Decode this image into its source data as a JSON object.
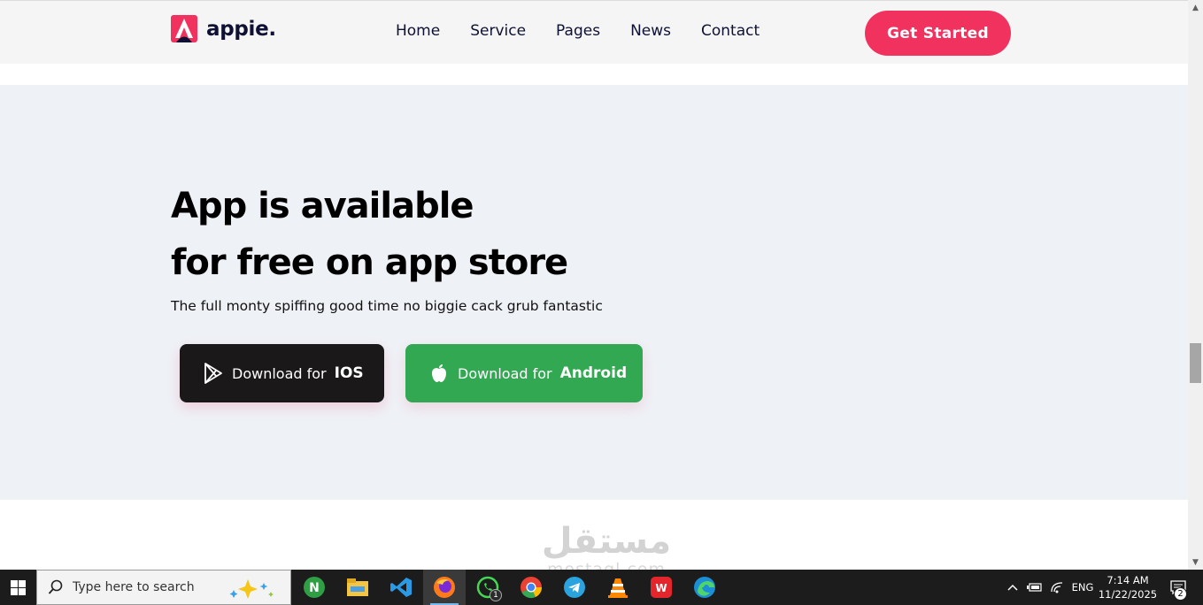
{
  "header": {
    "brand": "appie.",
    "nav": [
      "Home",
      "Service",
      "Pages",
      "News",
      "Contact"
    ],
    "cta_label": "Get Started"
  },
  "hero": {
    "title_line1": "App is available",
    "title_line2": "for free on app store",
    "subtitle": "The full monty spiffing good time no biggie cack grub fantastic",
    "ios_button": {
      "prefix": "Download for",
      "platform": "IOS"
    },
    "android_button": {
      "prefix": "Download for",
      "platform": "Android"
    }
  },
  "watermark": {
    "arabic": "مستقل",
    "latin": "mostaql.com"
  },
  "taskbar": {
    "search_placeholder": "Type here to search",
    "apps": [
      "node-icon",
      "file-explorer-icon",
      "vscode-icon",
      "firefox-icon",
      "whatsapp-icon",
      "chrome-icon",
      "telegram-icon",
      "vlc-icon",
      "wps-office-icon",
      "edge-icon"
    ],
    "whatsapp_badge": "1",
    "language": "ENG",
    "time": "7:14 AM",
    "date": "11/22/2025",
    "notification_count": "2"
  },
  "colors": {
    "accent": "#f2325e",
    "ios_button": "#1b1819",
    "android_button": "#33a852",
    "hero_bg": "#eef1f6",
    "header_bg": "#f5f5f5"
  }
}
